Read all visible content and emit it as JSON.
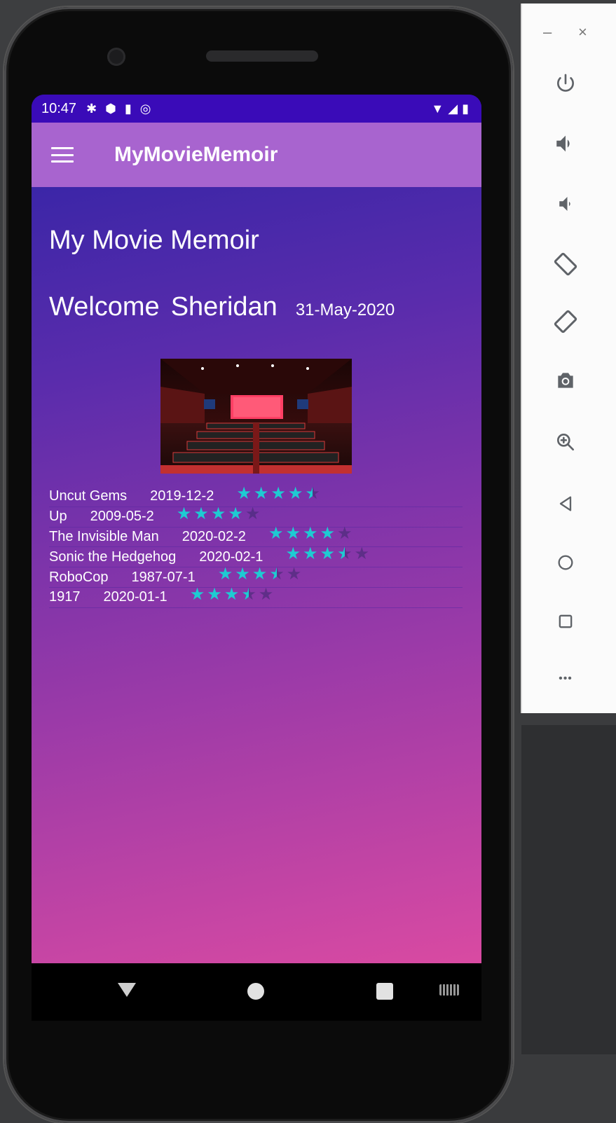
{
  "status_bar": {
    "time": "10:47"
  },
  "app_bar": {
    "title": "MyMovieMemoir"
  },
  "main": {
    "page_title": "My Movie Memoir",
    "welcome_label": "Welcome",
    "user_name": "Sheridan",
    "date": "31-May-2020"
  },
  "movies": [
    {
      "title": "Uncut Gems",
      "date": "2019-12-2",
      "rating": 4.5
    },
    {
      "title": "Up",
      "date": "2009-05-2",
      "rating": 4
    },
    {
      "title": "The Invisible Man",
      "date": "2020-02-2",
      "rating": 4
    },
    {
      "title": "Sonic the Hedgehog",
      "date": "2020-02-1",
      "rating": 3.5
    },
    {
      "title": "RoboCop",
      "date": "1987-07-1",
      "rating": 3.5
    },
    {
      "title": "1917",
      "date": "2020-01-1",
      "rating": 3.5
    }
  ],
  "colors": {
    "status_bar": "#3a0bb8",
    "app_bar": "#a864cf",
    "star": "#1ecbd2",
    "gradient_top": "#2d23a5",
    "gradient_bottom": "#d94aa2"
  },
  "toolbar": {
    "minimize_symbol": "–",
    "close_symbol": "×",
    "more_symbol": "•••",
    "icons": [
      "power-icon",
      "volume-up-icon",
      "volume-down-icon",
      "rotate-left-icon",
      "rotate-right-icon",
      "camera-icon",
      "zoom-icon",
      "back-icon",
      "home-icon",
      "overview-icon",
      "more-icon"
    ]
  }
}
